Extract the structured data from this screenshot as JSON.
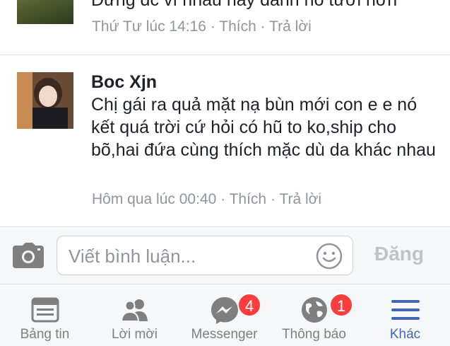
{
  "comments": [
    {
      "name": "",
      "text": "Đừng dc vì nhau hay đánh nó tươi hơn",
      "time": "Thứ Tư lúc 14:16",
      "like": "Thích",
      "reply": "Trả lời"
    },
    {
      "name": "Boc Xjn",
      "text": "Chị gái ra quả mặt nạ bùn mới con e e nó kết quá trời cứ hỏi có hũ to ko,ship cho bõ,hai đứa cùng thích mặc dù da khác nhau",
      "time": "Hôm qua lúc 00:40",
      "like": "Thích",
      "reply": "Trả lời"
    }
  ],
  "meta_separator": " · ",
  "composer": {
    "placeholder": "Viết bình luận...",
    "post_label": "Đăng"
  },
  "tabbar": {
    "items": [
      {
        "label": "Bảng tin",
        "icon": "news-feed-icon"
      },
      {
        "label": "Lời mời",
        "icon": "friend-requests-icon"
      },
      {
        "label": "Messenger",
        "icon": "messenger-icon",
        "badge": "4"
      },
      {
        "label": "Thông báo",
        "icon": "globe-icon",
        "badge": "1"
      },
      {
        "label": "Khác",
        "icon": "menu-icon",
        "active": true
      }
    ]
  },
  "colors": {
    "accent": "#4267b2",
    "badge": "#fa3e3e",
    "meta_text": "#90949c",
    "post_disabled": "#bec3c9"
  }
}
